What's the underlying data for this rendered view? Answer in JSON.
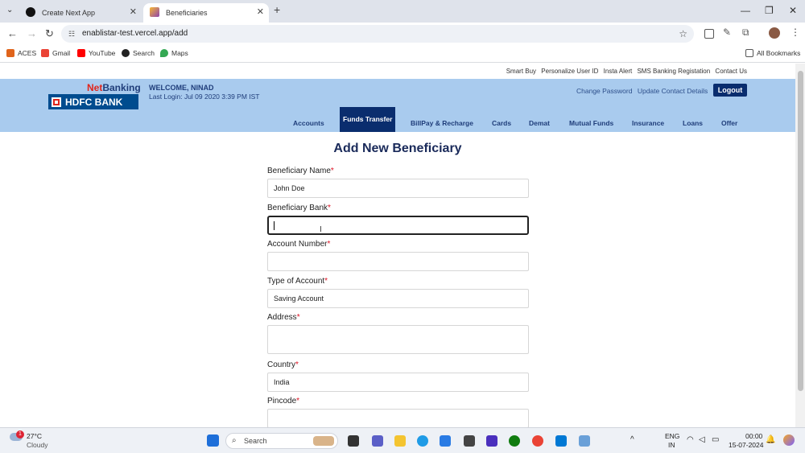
{
  "browser": {
    "tabs": [
      {
        "title": "Create Next App",
        "active": false
      },
      {
        "title": "Beneficiaries",
        "active": true
      }
    ],
    "url": "enablistar-test.vercel.app/add",
    "bookmarks": [
      "ACES",
      "Gmail",
      "YouTube",
      "Search",
      "Maps"
    ],
    "all_bookmarks": "All Bookmarks"
  },
  "site": {
    "top_links": [
      "Smart Buy",
      "Personalize User ID",
      "Insta Alert",
      "SMS Banking Registation",
      "Contact Us"
    ],
    "netbanking_net": "Net",
    "netbanking_banking": "Banking",
    "logo_text": "HDFC BANK",
    "welcome": "WELCOME, NINAD",
    "last_login": "Last Login: Jul 09 2020 3:39 PM IST",
    "header_links": [
      "Change Password",
      "Update Contact Details"
    ],
    "logout": "Logout",
    "nav": [
      "Accounts",
      "Funds Transfer",
      "BillPay & Recharge",
      "Cards",
      "Demat",
      "Mutual Funds",
      "Insurance",
      "Loans",
      "Offer"
    ],
    "active_nav": "Funds Transfer"
  },
  "form": {
    "title": "Add New Beneficiary",
    "fields": [
      {
        "label": "Beneficiary Name",
        "value": "John Doe"
      },
      {
        "label": "Beneficiary Bank",
        "value": ""
      },
      {
        "label": "Account Number",
        "value": ""
      },
      {
        "label": "Type of Account",
        "value": "Saving Account"
      },
      {
        "label": "Address",
        "value": ""
      },
      {
        "label": "Country",
        "value": "India"
      },
      {
        "label": "Pincode",
        "value": ""
      }
    ],
    "required_mark": "*"
  },
  "taskbar": {
    "weather_temp": "27°C",
    "weather_desc": "Cloudy",
    "weather_badge": "1",
    "search": "Search",
    "lang": "ENG",
    "region": "IN",
    "time": "00:00",
    "date": "15-07-2024"
  },
  "colors": {
    "header_bg": "#a9cbee",
    "nav_active": "#0a2d6e",
    "brand_blue": "#004c8f",
    "brand_red": "#e1251b"
  }
}
